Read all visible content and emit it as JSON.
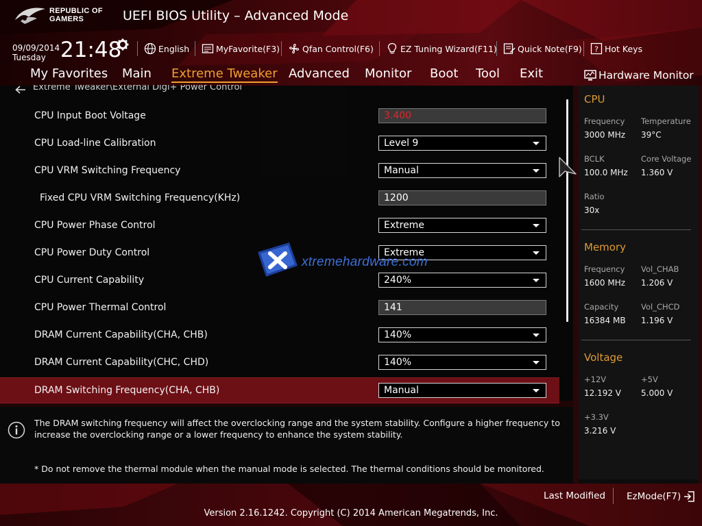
{
  "header": {
    "logo_line1": "REPUBLIC OF",
    "logo_line2": "GAMERS",
    "title": "UEFI BIOS Utility – Advanced Mode",
    "date": "09/09/2014",
    "day": "Tuesday",
    "time": "21:48"
  },
  "toolbar": {
    "language": "English",
    "my_favorite": "MyFavorite(F3)",
    "qfan": "Qfan Control(F6)",
    "ez_tuning": "EZ Tuning Wizard(F11)",
    "quick_note": "Quick Note(F9)",
    "hot_keys": "Hot Keys"
  },
  "nav": {
    "tabs": [
      "My Favorites",
      "Main",
      "Extreme Tweaker",
      "Advanced",
      "Monitor",
      "Boot",
      "Tool",
      "Exit"
    ],
    "active": "Extreme Tweaker"
  },
  "breadcrumb": "Extreme Tweaker\\External Digi+ Power Control",
  "settings": [
    {
      "label": "CPU Input Boot Voltage",
      "value": "3.400",
      "type": "input",
      "value_color": "#e0262b"
    },
    {
      "label": "CPU Load-line Calibration",
      "value": "Level 9",
      "type": "select"
    },
    {
      "label": "CPU VRM Switching Frequency",
      "value": "Manual",
      "type": "select"
    },
    {
      "label": "Fixed CPU VRM Switching Frequency(KHz)",
      "value": "1200",
      "type": "input",
      "indent": true
    },
    {
      "label": "CPU Power Phase Control",
      "value": "Extreme",
      "type": "select"
    },
    {
      "label": "CPU Power Duty Control",
      "value": "Extreme",
      "type": "select"
    },
    {
      "label": "CPU Current Capability",
      "value": "240%",
      "type": "select"
    },
    {
      "label": "CPU Power Thermal Control",
      "value": "141",
      "type": "input"
    },
    {
      "label": "DRAM Current Capability(CHA, CHB)",
      "value": "140%",
      "type": "select"
    },
    {
      "label": "DRAM Current Capability(CHC, CHD)",
      "value": "140%",
      "type": "select"
    },
    {
      "label": "DRAM Switching Frequency(CHA, CHB)",
      "value": "Manual",
      "type": "select",
      "selected": true
    }
  ],
  "help": {
    "description": "The DRAM switching frequency will affect the overclocking range and the system stability. Configure a higher frequency to increase the overclocking range or a lower frequency to enhance the system stability.",
    "note": "* Do not remove the thermal module when the manual mode is selected. The thermal conditions should be monitored."
  },
  "watermark": "xtremehardware.com",
  "hardware_monitor": {
    "title": "Hardware Monitor",
    "cpu": {
      "section": "CPU",
      "frequency_label": "Frequency",
      "frequency": "3000 MHz",
      "temperature_label": "Temperature",
      "temperature": "39°C",
      "bclk_label": "BCLK",
      "bclk": "100.0 MHz",
      "core_voltage_label": "Core Voltage",
      "core_voltage": "1.360 V",
      "ratio_label": "Ratio",
      "ratio": "30x"
    },
    "memory": {
      "section": "Memory",
      "frequency_label": "Frequency",
      "frequency": "1600 MHz",
      "vol_chab_label": "Vol_CHAB",
      "vol_chab": "1.206 V",
      "capacity_label": "Capacity",
      "capacity": "16384 MB",
      "vol_chcd_label": "Vol_CHCD",
      "vol_chcd": "1.196 V"
    },
    "voltage": {
      "section": "Voltage",
      "v12_label": "+12V",
      "v12": "12.192 V",
      "v5_label": "+5V",
      "v5": "5.000 V",
      "v33_label": "+3.3V",
      "v33": "3.216 V"
    }
  },
  "footer": {
    "last_modified": "Last Modified",
    "ezmode": "EzMode(F7)",
    "copyright": "Version 2.16.1242. Copyright (C) 2014 American Megatrends, Inc."
  },
  "colors": {
    "accent_orange": "#f0a030",
    "selection_red": "#6c1016",
    "value_red": "#e0262b",
    "hw_section": "#e09a34",
    "watermark_blue": "#3d6fd6"
  }
}
